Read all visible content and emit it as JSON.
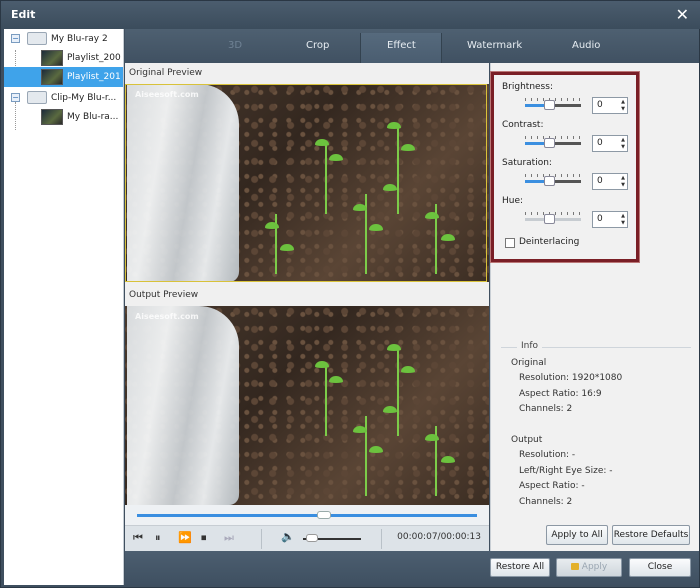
{
  "window": {
    "title": "Edit"
  },
  "tree": {
    "nodes": [
      {
        "label": "My Blu-ray 2"
      },
      {
        "label": "Playlist_200"
      },
      {
        "label": "Playlist_201"
      },
      {
        "label": "Clip-My Blu-r..."
      },
      {
        "label": "My Blu-ra..."
      }
    ]
  },
  "tabs": [
    "3D",
    "Crop",
    "Effect",
    "Watermark",
    "Audio"
  ],
  "preview": {
    "original_label": "Original Preview",
    "output_label": "Output Preview",
    "watermark": "Aiseesoft.com"
  },
  "playback": {
    "timecode": "00:00:07/00:00:13",
    "seek_position": 0.55,
    "volume_level": 0.15
  },
  "effect": {
    "brightness_label": "Brightness:",
    "brightness_value": "0",
    "contrast_label": "Contrast:",
    "contrast_value": "0",
    "saturation_label": "Saturation:",
    "saturation_value": "0",
    "hue_label": "Hue:",
    "hue_value": "0",
    "deinterlacing_label": "Deinterlacing"
  },
  "info": {
    "title": "Info",
    "original_heading": "Original",
    "original_resolution": "Resolution: 1920*1080",
    "original_aspect": "Aspect Ratio: 16:9",
    "original_channels": "Channels: 2",
    "output_heading": "Output",
    "output_resolution": "Resolution: -",
    "output_eye_size": "Left/Right Eye Size: -",
    "output_aspect": "Aspect Ratio: -",
    "output_channels": "Channels: 2"
  },
  "buttons": {
    "apply_to_all": "Apply to All",
    "restore_defaults": "Restore Defaults",
    "restore_all": "Restore All",
    "apply": "Apply",
    "close": "Close"
  },
  "colors": {
    "accent": "#3fa3ea",
    "highlight_border": "#7a1f26"
  }
}
